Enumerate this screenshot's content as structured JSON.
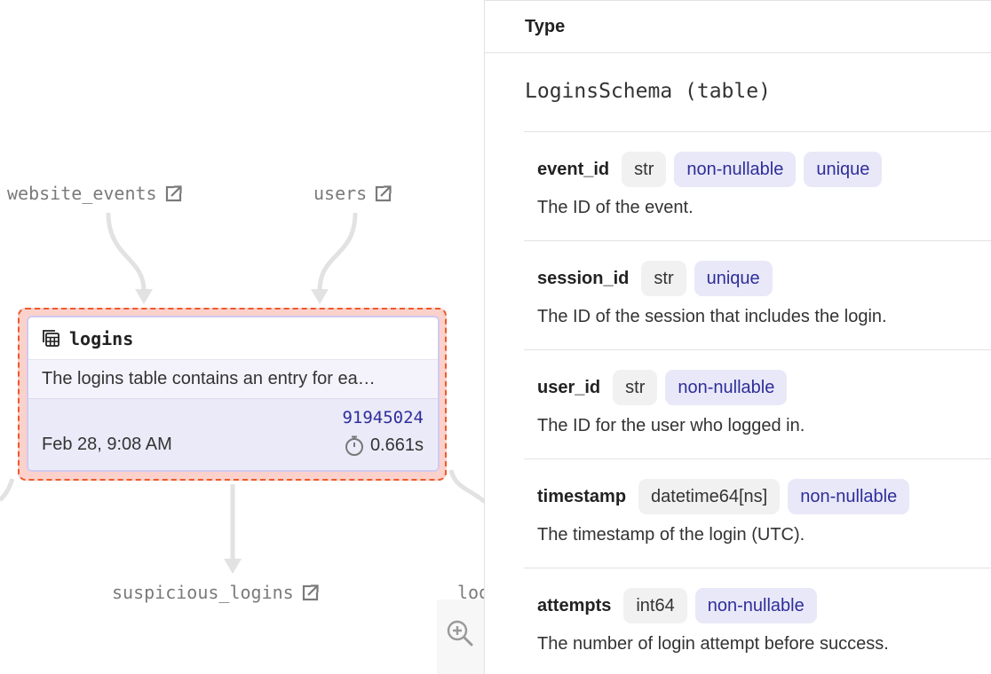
{
  "graph": {
    "upstream": [
      {
        "id": "website-events",
        "label": "website_events",
        "icon": "external-link-icon"
      },
      {
        "id": "users",
        "label": "users",
        "icon": "external-link-icon"
      }
    ],
    "downstream": [
      {
        "id": "suspicious",
        "label": "suspicious_logins",
        "icon": "external-link-icon"
      },
      {
        "id": "logins-partial",
        "label": "log"
      }
    ],
    "selected_node": {
      "title": "logins",
      "icon": "table-icon",
      "description": "The logins table contains an entry for ea…",
      "row_count": "91945024",
      "updated": "Feb 28, 9:08 AM",
      "duration": "0.661s",
      "duration_icon": "stopwatch-icon"
    },
    "zoom_icon": "zoom-in-icon"
  },
  "panel": {
    "header_label": "Type",
    "schema_title": "LoginsSchema (table)",
    "fields": [
      {
        "name": "event_id",
        "type": "str",
        "tags": [
          "non-nullable",
          "unique"
        ],
        "description": "The ID of the event."
      },
      {
        "name": "session_id",
        "type": "str",
        "tags": [
          "unique"
        ],
        "description": "The ID of the session that includes the login."
      },
      {
        "name": "user_id",
        "type": "str",
        "tags": [
          "non-nullable"
        ],
        "description": "The ID for the user who logged in."
      },
      {
        "name": "timestamp",
        "type": "datetime64[ns]",
        "tags": [
          "non-nullable"
        ],
        "description": "The timestamp of the login (UTC)."
      },
      {
        "name": "attempts",
        "type": "int64",
        "tags": [
          "non-nullable"
        ],
        "description": "The number of login attempt before success."
      }
    ]
  },
  "colors": {
    "selection_fill": "#fbd1cc",
    "selection_border": "#ee5a2a",
    "tag_text": "#2e2e9a",
    "tag_bg": "#e9e8f8",
    "edge": "#e2e2e2"
  }
}
